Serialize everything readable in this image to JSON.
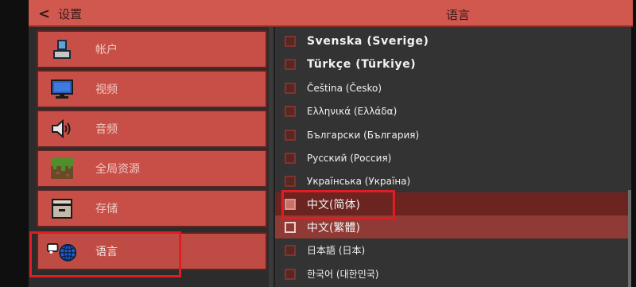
{
  "header": {
    "back_label": "设置",
    "title": "语言"
  },
  "sidebar": {
    "items": [
      {
        "label": "帐户",
        "icon": "user-icon"
      },
      {
        "label": "视频",
        "icon": "monitor-icon"
      },
      {
        "label": "音频",
        "icon": "speaker-icon"
      },
      {
        "label": "全局资源",
        "icon": "grass-block-icon"
      },
      {
        "label": "存储",
        "icon": "storage-drawer-icon"
      },
      {
        "label": "语言",
        "icon": "language-globe-icon",
        "active": true
      }
    ]
  },
  "languages": [
    {
      "label": "Svenska (Sverige)"
    },
    {
      "label": "Türkçe (Türkiye)"
    },
    {
      "label": "Čeština (Česko)"
    },
    {
      "label": "Ελληνικά (Ελλάδα)"
    },
    {
      "label": "Български (България)"
    },
    {
      "label": "Русский (Россия)"
    },
    {
      "label": "Українська (Україна)"
    },
    {
      "label": "中文(简体)",
      "state": "selected"
    },
    {
      "label": "中文(繁體)",
      "state": "hover"
    },
    {
      "label": "日本語 (日本)"
    },
    {
      "label": "한국어 (대한민국)"
    }
  ],
  "colors": {
    "header": "#d0584f",
    "sidebar_button": "#c84f47",
    "panel": "#333333",
    "annotation": "#e01d22"
  }
}
